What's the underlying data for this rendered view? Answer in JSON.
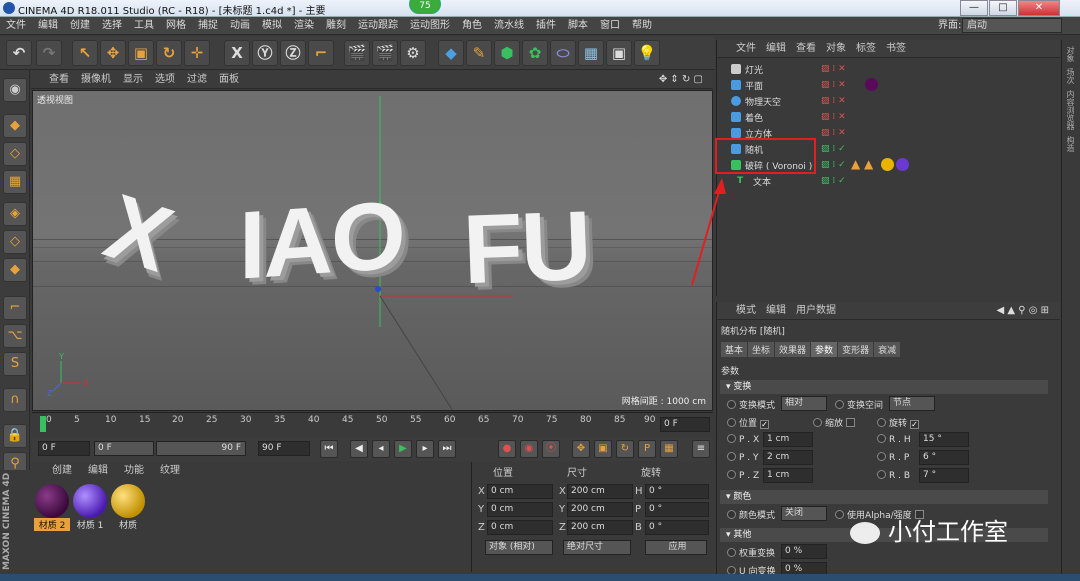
{
  "title_bar": {
    "text": "CINEMA 4D R18.011 Studio (RC - R18) - [未标题 1.c4d *] - 主要",
    "badge": "75",
    "minimize": "—",
    "maximize": "□",
    "close": "✕"
  },
  "menu_bar": {
    "items": [
      "文件",
      "编辑",
      "创建",
      "选择",
      "工具",
      "网格",
      "捕捉",
      "动画",
      "模拟",
      "渲染",
      "雕刻",
      "运动跟踪",
      "运动图形",
      "角色",
      "流水线",
      "插件",
      "脚本",
      "窗口",
      "帮助"
    ],
    "interface_label": "界面:",
    "interface_value": "启动"
  },
  "viewport_menu": {
    "items": [
      "查看",
      "摄像机",
      "显示",
      "选项",
      "过滤",
      "面板"
    ]
  },
  "viewport": {
    "label": "透视视图",
    "grid_info": "网格间距 : 1000 cm",
    "text3d": [
      "X",
      "IAO",
      "FU"
    ]
  },
  "timeline": {
    "ticks": [
      "0",
      "5",
      "10",
      "15",
      "20",
      "25",
      "30",
      "35",
      "40",
      "45",
      "50",
      "55",
      "60",
      "65",
      "70",
      "75",
      "80",
      "85",
      "90"
    ],
    "current": "0 F"
  },
  "transport": {
    "start": "0 F",
    "range_start": "0 F",
    "range_end": "90 F",
    "end": "90 F"
  },
  "material_panel": {
    "menu": [
      "创建",
      "编辑",
      "功能",
      "纹理"
    ],
    "materials": [
      {
        "name": "材质 2",
        "color": "#3a0a3a"
      },
      {
        "name": "材质 1",
        "color": "#6a3ad0"
      },
      {
        "name": "材质",
        "color": "#e8b400"
      }
    ],
    "brand": "MAXON CINEMA 4D"
  },
  "coordinates": {
    "headers": [
      "位置",
      "尺寸",
      "旋转"
    ],
    "rows": [
      {
        "axis": "X",
        "pos": "0 cm",
        "size_axis": "X",
        "size": "200 cm",
        "rot_axis": "H",
        "rot": "0 °"
      },
      {
        "axis": "Y",
        "pos": "0 cm",
        "size_axis": "Y",
        "size": "200 cm",
        "rot_axis": "P",
        "rot": "0 °"
      },
      {
        "axis": "Z",
        "pos": "0 cm",
        "size_axis": "Z",
        "size": "200 cm",
        "rot_axis": "B",
        "rot": "0 °"
      }
    ],
    "mode": "对象 (相对)",
    "size_mode": "绝对尺寸",
    "apply": "应用"
  },
  "object_manager": {
    "menu": [
      "文件",
      "编辑",
      "查看",
      "对象",
      "标签",
      "书签"
    ],
    "objects": [
      {
        "name": "灯光",
        "icon_color": "#cccccc"
      },
      {
        "name": "平面",
        "icon_color": "#4a9be0"
      },
      {
        "name": "物理天空",
        "icon_color": "#4a9be0"
      },
      {
        "name": "着色",
        "icon_color": "#4a9be0"
      },
      {
        "name": "立方体",
        "icon_color": "#4a9be0"
      },
      {
        "name": "随机",
        "icon_color": "#4a9be0"
      },
      {
        "name": "破碎 ( Voronoi )",
        "icon_color": "#3ac060"
      },
      {
        "name": "文本",
        "icon_color": "#3ac060"
      }
    ]
  },
  "attribute_manager": {
    "menu": [
      "模式",
      "编辑",
      "用户数据"
    ],
    "object_title": "随机分布 [随机]",
    "tabs": [
      "基本",
      "坐标",
      "效果器",
      "参数",
      "变形器",
      "衰减"
    ],
    "active_tab": "参数",
    "section_params": "参数",
    "section_transform": "▾ 变换",
    "transform_mode_label": "变换模式",
    "transform_mode": "相对",
    "transform_space_label": "变换空间",
    "transform_space": "节点",
    "pos_label": "位置",
    "scale_label": "缩放",
    "rot_label": "旋转",
    "px_label": "P . X",
    "px": "1 cm",
    "py_label": "P . Y",
    "py": "2 cm",
    "pz_label": "P . Z",
    "pz": "1 cm",
    "rh_label": "R . H",
    "rh": "15 °",
    "rp_label": "R . P",
    "rp": "6 °",
    "rb_label": "R . B",
    "rb": "7 °",
    "section_color": "▾ 颜色",
    "color_mode_label": "颜色模式",
    "color_mode": "关闭",
    "use_alpha": "使用Alpha/强度",
    "section_other": "▾ 其他",
    "weight_label": "权重变换",
    "weight": "0 %",
    "uv_label": "U 向变换",
    "uv": "0 %"
  },
  "right_strip": [
    "对象",
    "场次",
    "内容浏览器",
    "构造"
  ],
  "watermark": {
    "text": "小付工作室"
  }
}
